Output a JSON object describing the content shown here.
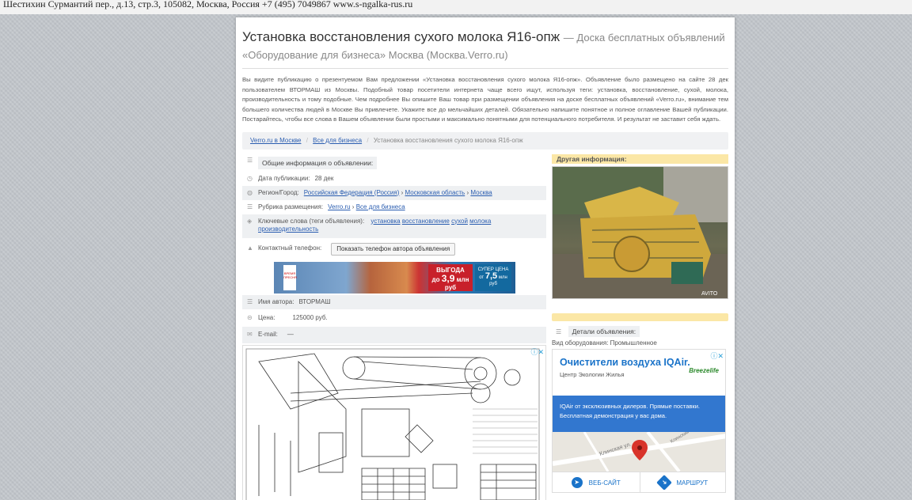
{
  "topbar": {
    "text": "Шестихин Сурмантий пер., д.13, стр.3, 105082, Москва, Россия +7 (495) 7049867 www.s-ngalka-rus.ru"
  },
  "header": {
    "title": "Установка восстановления сухого молока Я16-опж",
    "title_suffix": "— Доска бесплатных объявлений",
    "subtitle": "«Оборудование для бизнеса» Москва (Москва.Verro.ru)"
  },
  "description": "Вы видите публикацию о презентуемом Вам предложении «Установка восстановления сухого молока Я16-опж». Объявление было размещено на сайте 28 дек пользователем ВТОРМАШ из Москвы. Подобный товар посетители интернета чаще всего ищут, используя теги: установка, восстановление, сухой, молока, производительность и тому подобные. Чем подробнее Вы опишите Ваш товар при размещении объявления на доске бесплатных объявлений «Verro.ru», внимание тем большего количества людей в Москве Вы привлечете. Укажите все до мельчайших деталей. Обязательно напишите понятное и полное оглавление Вашей публикации. Постарайтесь, чтобы все слова в Вашем объявлении были простыми и максимально понятными для потенциального потребителя. И результат не заставит себя ждать.",
  "breadcrumb": {
    "home": "Verro.ru в Москве",
    "category": "Все для бизнеса",
    "current": "Установка восстановления сухого молока Я16-опж",
    "separator": "/"
  },
  "info": {
    "header": "Общие информация о объявлении:",
    "date_label": "Дата публикации:",
    "date_value": "28 дек",
    "region_label": "Регион/Город:",
    "region_country": "Российская Федерация (Россия)",
    "region_area": "Московская область",
    "region_city": "Москва",
    "rubric_label": "Рубрика размещения:",
    "rubric_site": "Verro.ru",
    "rubric_cat": "Все для бизнеса",
    "tags_label": "Ключевые слова (теги объявления):",
    "tags": [
      "установка",
      "восстановление",
      "сухой",
      "молока",
      "производительность"
    ],
    "phone_label": "Контактный телефон:",
    "phone_button": "Показать телефон автора объявления",
    "author_label": "Имя автора:",
    "author_value": "ВТОРМАШ",
    "price_label": "Цена:",
    "price_value": "125000 руб.",
    "email_label": "E-mail:",
    "email_value": "—",
    "arrow": "›"
  },
  "banner": {
    "left_text": "ВРЕМЯ ПРЕСНЯ",
    "promo_title": "ВЫГОДА",
    "promo_prefix": "до",
    "promo_value": "3,9",
    "promo_unit": "млн руб",
    "price_title": "СУПЕР ЦЕНА",
    "price_prefix": "от",
    "price_value": "7,5",
    "price_unit": "млн руб"
  },
  "right": {
    "other_info": "Другая информация:",
    "photo_watermark": "AVITO",
    "details_header": "Детали объявления:",
    "details_line": "Вид оборудования: Промышленное"
  },
  "ad": {
    "adchoices": "ⓘ✕",
    "title": "Очистители воздуха IQAir.",
    "subtitle": "Центр Экологии Жилья",
    "brand": "Breezelife",
    "body": "IQAir от эксклюзивных дилеров. Прямые поставки. Бесплатная демонстрация у вас дома.",
    "map_label_1": "Клинская ул.",
    "map_label_2": "Клинский пр.",
    "btn_site": "ВЕБ-САЙТ",
    "btn_route": "МАРШРУТ"
  },
  "icons": {
    "info": "☰",
    "clock": "◷",
    "globe": "◍",
    "list": "☰",
    "tag": "◈",
    "phone": "▲",
    "user": "☰",
    "price": "⊝",
    "email": "✉"
  }
}
